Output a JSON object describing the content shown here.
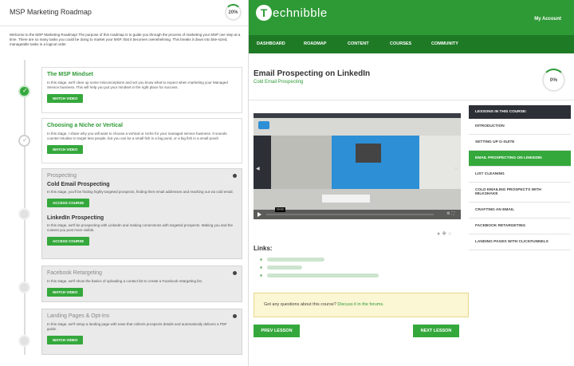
{
  "left": {
    "title": "MSP Marketing Roadmap",
    "progress": "20%",
    "intro": "Welcome to the MSP Marketing Roadmap! The purpose of this roadmap is to guide you through the process of marketing your MSP one step at a time. There are so many tasks you could be doing to market your MSP, that it becomes overwhelming. This breaks it down into bite-sized, manageable tasks in a logical order.",
    "stages": [
      {
        "title": "The MSP Mindset",
        "status": "complete",
        "desc": "In this stage, we'll clear up some misconceptions and set you know what to expect when marketing your Managed Service business. This will help you put your mindset in the right place for success.",
        "button": "WATCH VIDEO"
      },
      {
        "title": "Choosing a Niche or Vertical",
        "status": "in-progress",
        "desc": "In this stage, I share why you will want to choose a vertical or niche for your managed service business. It sounds counter-intuitive to target less people, but you can be a small fish in a big pond, or a big fish in a small pond!",
        "button": "WATCH VIDEO"
      },
      {
        "title": "Prospecting",
        "status": "locked",
        "subs": [
          {
            "title": "Cold Email Prospecting",
            "desc": "In this stage, you'll be finding highly-targeted prospects, finding their email addresses and reaching out via cold email.",
            "button": "ACCESS COURSE"
          },
          {
            "title": "LinkedIn Prospecting",
            "desc": "In this stage, we'll be prospecting with LinkedIn and making connections with targeted prospects. Making you and the content you post more visible.",
            "button": "ACCESS COURSE"
          }
        ]
      },
      {
        "title": "Facebook Retargeting",
        "status": "locked",
        "desc": "In this stage, we'll show the basics of uploading a contact list to create a Facebook retargeting list.",
        "button": "WATCH VIDEO"
      },
      {
        "title": "Landing Pages & Opt-Ins",
        "status": "locked",
        "desc": "In this stage, we'll setup a landing page with ease that collects prospects details and automatically delivers a PDF guide.",
        "button": "WATCH VIDEO"
      }
    ]
  },
  "brand": {
    "logo_letter": "T",
    "name": "echnibble"
  },
  "header": {
    "account": "My Account"
  },
  "nav": [
    "DASHBOARD",
    "ROADMAP",
    "CONTENT",
    "COURSES",
    "COMMUNITY"
  ],
  "lesson": {
    "title": "Email Prospecting on LinkedIn",
    "subtitle": "Cold Email Prospecting",
    "progress": "0%",
    "video_time": "20:53",
    "links_label": "Links:",
    "question_prefix": "Got any questions about this course?",
    "question_link": "Discuss it in the forums.",
    "prev": "PREV LESSON",
    "next": "NEXT LESSON"
  },
  "sidebar": {
    "heading": "LESSONS IN THIS COURSE:",
    "items": [
      {
        "label": "INTRODUCTION",
        "active": false
      },
      {
        "label": "SETTING UP G-SUITE",
        "active": false
      },
      {
        "label": "EMAIL PROSPECTING ON LINKEDIN",
        "active": true
      },
      {
        "label": "LIST CLEANING",
        "active": false
      },
      {
        "label": "COLD EMAILING PROSPECTS WITH MILKSHAKE",
        "active": false
      },
      {
        "label": "CRAFTING AN EMAIL",
        "active": false
      },
      {
        "label": "FACEBOOK RETARGETING",
        "active": false
      },
      {
        "label": "LANDING PAGES WITH CLICKFUNNELS",
        "active": false
      }
    ]
  },
  "colors": {
    "brand_green": "#2e9a36",
    "nav_green": "#1f7a26",
    "notice_bg": "#fbf6d3"
  }
}
